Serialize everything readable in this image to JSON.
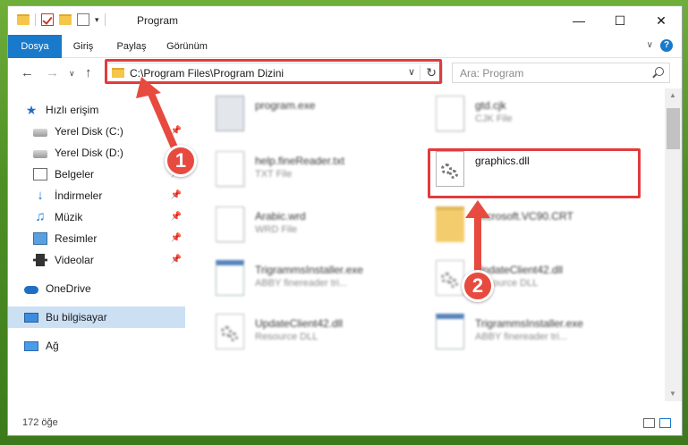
{
  "window": {
    "title": "Program",
    "minimize_icon": "minimize-icon",
    "maximize_icon": "maximize-icon",
    "close_icon": "close-icon"
  },
  "ribbon": {
    "tabs": [
      {
        "label": "Dosya",
        "active": true
      },
      {
        "label": "Giriş",
        "active": false
      },
      {
        "label": "Paylaş",
        "active": false
      },
      {
        "label": "Görünüm",
        "active": false
      }
    ],
    "accent": "#1979ca"
  },
  "address": {
    "path": "C:\\Program Files\\Program Dizini"
  },
  "search": {
    "placeholder": "Ara: Program"
  },
  "sidebar": {
    "items": [
      {
        "label": "Hızlı erişim",
        "icon": "star-icon",
        "pinned": false
      },
      {
        "label": "Yerel Disk (C:)",
        "icon": "drive-icon",
        "pinned": true
      },
      {
        "label": "Yerel Disk (D:)",
        "icon": "drive-icon",
        "pinned": true
      },
      {
        "label": "Belgeler",
        "icon": "documents-icon",
        "pinned": true
      },
      {
        "label": "İndirmeler",
        "icon": "download-icon",
        "pinned": true
      },
      {
        "label": "Müzik",
        "icon": "music-icon",
        "pinned": true
      },
      {
        "label": "Resimler",
        "icon": "pictures-icon",
        "pinned": true
      },
      {
        "label": "Videolar",
        "icon": "videos-icon",
        "pinned": true
      },
      {
        "label": "OneDrive",
        "icon": "cloud-icon",
        "pinned": false
      },
      {
        "label": "Bu bilgisayar",
        "icon": "computer-icon",
        "pinned": false,
        "selected": true
      },
      {
        "label": "Ağ",
        "icon": "network-icon",
        "pinned": false
      }
    ]
  },
  "files": [
    {
      "name": "program.exe",
      "type": ""
    },
    {
      "name": "gtd.cjk",
      "type": "CJK File"
    },
    {
      "name": "help.fineReader.txt",
      "type": "TXT File"
    },
    {
      "name": "graphics.dll",
      "type": ""
    },
    {
      "name": "Arabic.wrd",
      "type": "WRD File"
    },
    {
      "name": "Microsoft.VC90.CRT",
      "type": ""
    },
    {
      "name": "TrigrammsInstaller.exe",
      "type": "ABBY finereader tri..."
    },
    {
      "name": "UpdateClient42.dll",
      "type": "Resource DLL"
    },
    {
      "name": "UpdateClient42.dll",
      "type": "Resource DLL"
    },
    {
      "name": "TrigrammsInstaller.exe",
      "type": "ABBY finereader tri..."
    }
  ],
  "status": {
    "count": "172 öğe"
  },
  "annotations": {
    "step1": "1",
    "step2": "2",
    "color": "#e23b3b"
  }
}
